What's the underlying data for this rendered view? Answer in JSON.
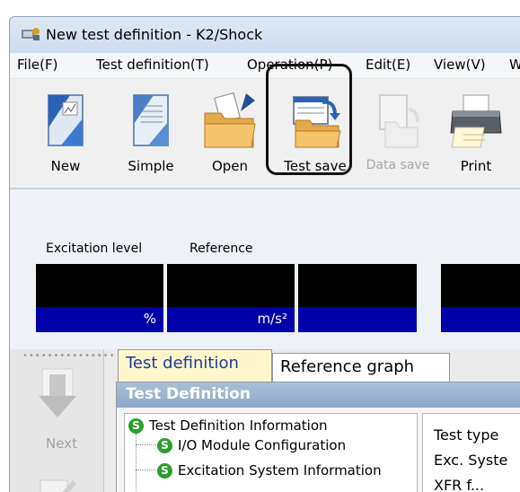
{
  "window": {
    "title": "New test definition - K2/Shock"
  },
  "menu": [
    "File(F)",
    "Test definition(T)",
    "Operation(P)",
    "Edit(E)",
    "View(V)",
    "W"
  ],
  "toolbar": {
    "new": "New",
    "simple": "Simple",
    "open": "Open",
    "test_save": "Test save",
    "data_save": "Data save",
    "print": "Print"
  },
  "monitor": {
    "excitation_label": "Excitation level",
    "reference_label": "Reference",
    "excitation_unit": "%",
    "reference_unit": "m/s²"
  },
  "nav": {
    "next": "Next"
  },
  "tabs": {
    "test_definition": "Test definition",
    "reference_graph": "Reference graph"
  },
  "section": {
    "header": "Test Definition"
  },
  "tree": {
    "root": "Test Definition Information",
    "child1": "I/O Module Configuration",
    "child2": "Excitation System Information"
  },
  "props": {
    "test_type": "Test type",
    "exc_system": "Exc. Syste",
    "xfr": "XFR f..."
  },
  "colors": {
    "meter_bg": "#000000",
    "unit_bar": "#0000aa",
    "tab_active": "#fff6cc",
    "header": "#8ea9c8"
  }
}
